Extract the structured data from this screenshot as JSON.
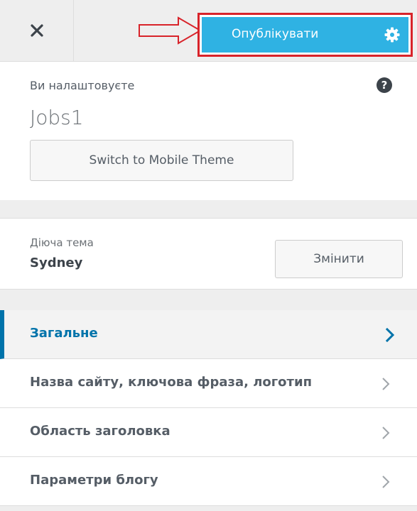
{
  "header": {
    "close_glyph": "✕",
    "publish_label": "Опублікувати",
    "annotation_color": "#d8232a",
    "publish_color": "#2fb2e3"
  },
  "info": {
    "customizing_label": "Ви налаштовуєте",
    "site_name": "Jobs1",
    "help_glyph": "?",
    "mobile_button_label": "Switch to Mobile Theme"
  },
  "theme": {
    "caption": "Діюча тема",
    "name": "Sydney",
    "change_label": "Змінити"
  },
  "menu": {
    "accent_color": "#0073aa",
    "items": [
      {
        "label": "Загальне",
        "active": true
      },
      {
        "label": "Назва сайту, ключова фраза, логотип",
        "active": false
      },
      {
        "label": "Область заголовка",
        "active": false
      },
      {
        "label": "Параметри блогу",
        "active": false
      }
    ]
  },
  "icons": [
    "close-icon",
    "arrow-annotation-icon",
    "gear-icon",
    "help-icon",
    "chevron-right-icon"
  ]
}
